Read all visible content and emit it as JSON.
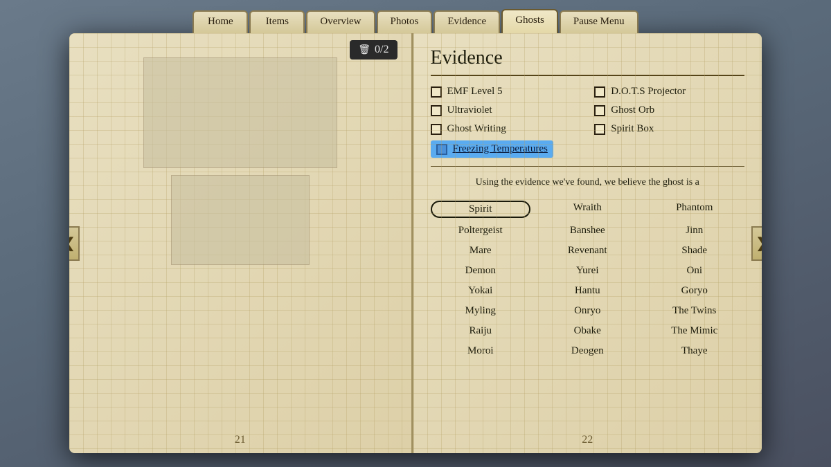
{
  "nav": {
    "tabs": [
      {
        "label": "Home",
        "active": false
      },
      {
        "label": "Items",
        "active": false
      },
      {
        "label": "Overview",
        "active": false
      },
      {
        "label": "Photos",
        "active": false
      },
      {
        "label": "Evidence",
        "active": false
      },
      {
        "label": "Ghosts",
        "active": true
      },
      {
        "label": "Pause Menu",
        "active": false
      }
    ]
  },
  "book": {
    "left_page_num": "21",
    "right_page_num": "22",
    "trash_label": "0/2",
    "arrow_left": "❮",
    "arrow_right": "❯"
  },
  "evidence": {
    "title": "Evidence",
    "items": [
      {
        "label": "EMF Level 5",
        "checked": false
      },
      {
        "label": "D.O.T.S Projector",
        "checked": false
      },
      {
        "label": "Ultraviolet",
        "checked": false
      },
      {
        "label": "Ghost Orb",
        "checked": false
      },
      {
        "label": "Ghost Writing",
        "checked": false
      },
      {
        "label": "Spirit Box",
        "checked": false
      },
      {
        "label": "Freezing Temperatures",
        "checked": true,
        "highlighted": true
      }
    ]
  },
  "belief_text": "Using the evidence we've found, we believe the ghost is a",
  "ghosts": {
    "list": [
      {
        "name": "Spirit",
        "selected": true
      },
      {
        "name": "Wraith",
        "selected": false
      },
      {
        "name": "Phantom",
        "selected": false
      },
      {
        "name": "Poltergeist",
        "selected": false
      },
      {
        "name": "Banshee",
        "selected": false
      },
      {
        "name": "Jinn",
        "selected": false
      },
      {
        "name": "Mare",
        "selected": false
      },
      {
        "name": "Revenant",
        "selected": false
      },
      {
        "name": "Shade",
        "selected": false
      },
      {
        "name": "Demon",
        "selected": false
      },
      {
        "name": "Yurei",
        "selected": false
      },
      {
        "name": "Oni",
        "selected": false
      },
      {
        "name": "Yokai",
        "selected": false
      },
      {
        "name": "Hantu",
        "selected": false
      },
      {
        "name": "Goryo",
        "selected": false
      },
      {
        "name": "Myling",
        "selected": false
      },
      {
        "name": "Onryo",
        "selected": false
      },
      {
        "name": "The Twins",
        "selected": false
      },
      {
        "name": "Raiju",
        "selected": false
      },
      {
        "name": "Obake",
        "selected": false
      },
      {
        "name": "The Mimic",
        "selected": false
      },
      {
        "name": "Moroi",
        "selected": false
      },
      {
        "name": "Deogen",
        "selected": false
      },
      {
        "name": "Thaye",
        "selected": false
      }
    ]
  }
}
